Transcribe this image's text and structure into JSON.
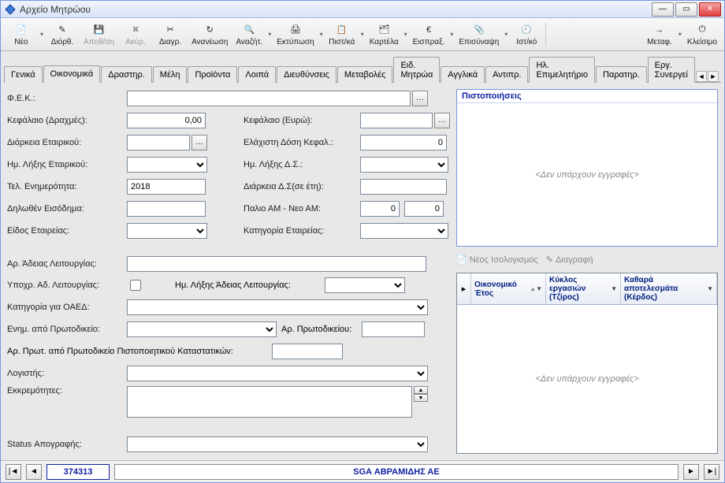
{
  "title": "Αρχείο Μητρώου",
  "toolbar": [
    {
      "label": "Νέο",
      "icon": "📄",
      "drop": true
    },
    {
      "label": "Διόρθ.",
      "icon": "✎",
      "drop": false
    },
    {
      "label": "Αποθ/ση",
      "icon": "💾",
      "drop": false,
      "disabled": true
    },
    {
      "label": "Ακύρ.",
      "icon": "✖",
      "drop": false,
      "disabled": true
    },
    {
      "label": "Διαγρ.",
      "icon": "✂",
      "drop": false
    },
    {
      "label": "Ανανέωση",
      "icon": "↻",
      "drop": false
    },
    {
      "label": "Αναζήτ.",
      "icon": "🔍",
      "drop": true
    },
    {
      "label": "Εκτύπωση",
      "icon": "🖨",
      "drop": true
    },
    {
      "label": "Πιστ/κά",
      "icon": "📋",
      "drop": true
    },
    {
      "label": "Καρτέλα",
      "icon": "🗂",
      "drop": true
    },
    {
      "label": "Εισπραξ.",
      "icon": "€",
      "drop": true
    },
    {
      "label": "Επισύναψη",
      "icon": "📎",
      "drop": true
    },
    {
      "label": "Ιστ/κό",
      "icon": "🕘",
      "drop": false
    },
    {
      "label": "Μεταφ.",
      "icon": "→",
      "drop": true
    },
    {
      "label": "Κλείσιμο",
      "icon": "⏻",
      "drop": false
    }
  ],
  "tabs": [
    "Γενικά",
    "Οικονομικά",
    "Δραστηρ.",
    "Μέλη",
    "Προϊόντα",
    "Λοιπά",
    "Διευθύνσεις",
    "Μεταβολές",
    "Ειδ. Μητρώα",
    "Αγγλικά",
    "Αντιπρ.",
    "Ηλ. Επιμελητήριο",
    "Παρατηρ.",
    "Εργ. Συνεργεί"
  ],
  "active_tab": 1,
  "form": {
    "fek_label": "Φ.Ε.Κ.:",
    "fek_value": "",
    "kefalaio_dr_label": "Κεφάλαιο (Δραχμές):",
    "kefalaio_dr_value": "0,00",
    "kefalaio_eu_label": "Κεφάλαιο (Ευρώ):",
    "kefalaio_eu_value": "",
    "diarkeia_et_label": "Διάρκεια Εταιρικού:",
    "diarkeia_et_value": "",
    "elax_dosi_label": "Ελάχιστη Δόση Κεφαλ.:",
    "elax_dosi_value": "0",
    "liksi_et_label": "Ημ. Λήξης Εταιρικού:",
    "liksi_et_value": "",
    "liksi_ds_label": "Ημ. Λήξης Δ.Σ.:",
    "liksi_ds_value": "",
    "tel_enim_label": "Τελ. Ενημερότητα:",
    "tel_enim_value": "2018",
    "diarkeia_ds_label": "Διάρκεια Δ.Σ(σε έτη):",
    "diarkeia_ds_value": "",
    "eisodima_label": "Δηλωθέν Εισόδημα:",
    "eisodima_value": "",
    "am_label": "Παλιο ΑΜ - Νεο ΑΜ:",
    "am1_value": "0",
    "am2_value": "0",
    "eidos_label": "Είδος Εταιρείας:",
    "katig_label": "Κατηγορία Εταιρείας:",
    "ar_adeias_label": "Αρ. Άδειας Λειτουργίας:",
    "ypoxr_label": "Υποχρ. Αδ. Λειτουργίας:",
    "liksi_adeias_label": "Ημ. Λήξης Άδειας Λειτουργίας:",
    "oaed_label": "Κατηγορία για ΟΑΕΔ:",
    "enim_proto_label": "Ενημ. από Πρωτοδικείο:",
    "ar_proto_label": "Αρ. Πρωτοδικείου:",
    "ar_prot_katast_label": "Αρ. Πρωτ. από Πρωτοδικείο Πιστοποιητικού Καταστατικών:",
    "logistis_label": "Λογιστής:",
    "ekkrem_label": "Εκκρεμότητες:",
    "status_label": "Status Απογραφής:"
  },
  "panel": {
    "title": "Πιστοποιήσεις",
    "empty": "<Δεν υπάρχουν εγγραφές>"
  },
  "mini": {
    "new_isol": "Νέος Ισολογισμός",
    "delete": "Διαγραφή"
  },
  "grid": {
    "col1": "Οικονομικό Έτος",
    "col2": "Κύκλος εργασιών (Τζίρος)",
    "col3": "Καθαρά αποτελεσμάτα (Κέρδος)",
    "empty": "<Δεν υπάρχουν εγγραφές>"
  },
  "footer": {
    "record_id": "374313",
    "record_name": "SGA ΑΒΡΑΜΙΔΗΣ ΑΕ"
  }
}
